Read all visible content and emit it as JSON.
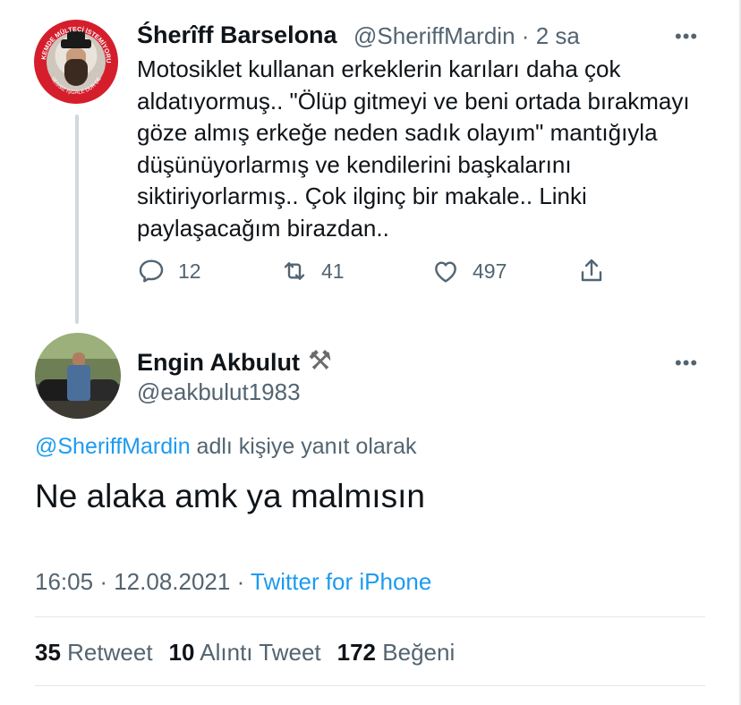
{
  "parent_tweet": {
    "display_name": "Śherîff Barselona",
    "handle": "@SheriffMardin",
    "separator": "·",
    "time_ago": "2 sa",
    "more_icon": "more-horizontal-icon",
    "body": "Motosiklet kullanan erkeklerin karıları daha çok aldatıyormuş.. \"Ölüp gitmeyi ve beni ortada bırakmayı göze almış erkeğe neden sadık olayım\" mantığıyla düşünüyorlarmış ve kendilerini başkalarını siktiriyorlarmış.. Çok ilginç bir makale.. Linki paylaşacağım birazdan..",
    "actions": {
      "reply_count": "12",
      "retweet_count": "41",
      "like_count": "497"
    },
    "avatar_ring_text_top": "ÜLKEMDE MÜLTECİ İSTEMİYORUM",
    "avatar_ring_text_bottom": "SESSİZ İŞGALE DUR DE"
  },
  "reply_tweet": {
    "display_name": "Engin Akbulut",
    "name_emoji": "⚒",
    "handle": "@eakbulut1983",
    "more_icon": "more-horizontal-icon",
    "replying_to_mention": "@SheriffMardin",
    "replying_to_suffix": " adlı kişiye yanıt olarak",
    "text": "Ne alaka amk ya malmısın",
    "time": "16:05",
    "date": "12.08.2021",
    "meta_separator": "·",
    "source": "Twitter for iPhone",
    "stats": {
      "retweets_count": "35",
      "retweets_label": "Retweet",
      "quotes_count": "10",
      "quotes_label": "Alıntı Tweet",
      "likes_count": "172",
      "likes_label": "Beğeni"
    }
  },
  "colors": {
    "link": "#1d9bf0",
    "secondary_text": "#536471",
    "primary_text": "#0f1419",
    "thread_line": "#cfd9de",
    "avatar_badge_red": "#d51e2c"
  }
}
